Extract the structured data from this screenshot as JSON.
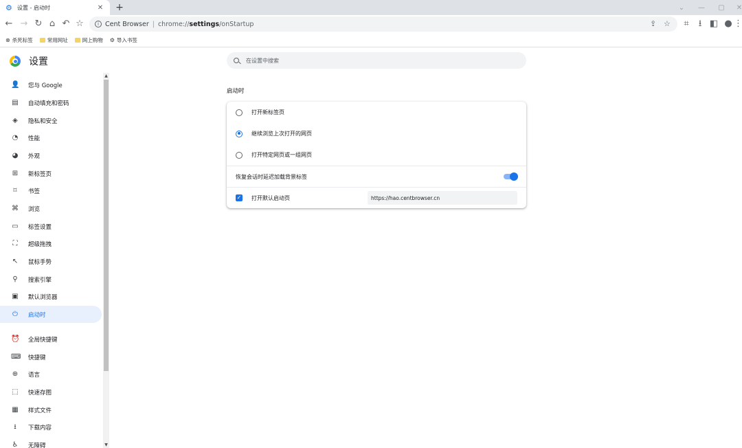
{
  "tab": {
    "title": "设置 - 启动时",
    "favicon": "gear-icon",
    "close": "✕",
    "new_tab": "+"
  },
  "window_controls": [
    "chevron-down-icon",
    "minimize-icon",
    "restore-icon",
    "close-icon"
  ],
  "toolbar": {
    "nav_icons": [
      "back-icon",
      "forward-icon",
      "reload-icon",
      "home-icon",
      "undo-close-icon",
      "star-icon"
    ],
    "site_name": "Cent Browser",
    "url_prefix": "chrome://",
    "url_bold": "settings",
    "url_suffix": "/onStartup",
    "right_icons": [
      "share-icon",
      "bookmark-star-icon",
      "crop-icon",
      "download-icon",
      "sidepanel-icon",
      "profile-icon",
      "menu-icon"
    ]
  },
  "bookmarks": [
    {
      "label": "杀死标签",
      "icon": "kill-tab-icon"
    },
    {
      "label": "常用网址",
      "icon": "folder-icon"
    },
    {
      "label": "网上购物",
      "icon": "folder-icon"
    },
    {
      "label": "导入书签",
      "icon": "gear-icon"
    }
  ],
  "header": {
    "title": "设置",
    "search_placeholder": "在设置中搜索"
  },
  "sidebar": {
    "items": [
      {
        "label": "您与 Google",
        "icon": "person-icon",
        "glyph": "👤"
      },
      {
        "label": "自动填充和密码",
        "icon": "clipboard-icon",
        "glyph": "▤"
      },
      {
        "label": "隐私和安全",
        "icon": "shield-icon",
        "glyph": "◈"
      },
      {
        "label": "性能",
        "icon": "speedometer-icon",
        "glyph": "◔"
      },
      {
        "label": "外观",
        "icon": "palette-icon",
        "glyph": "◕"
      },
      {
        "label": "新标签页",
        "icon": "new-tab-icon",
        "glyph": "⊞"
      },
      {
        "label": "书签",
        "icon": "bookmark-icon",
        "glyph": "⌑"
      },
      {
        "label": "浏览",
        "icon": "browse-icon",
        "glyph": "⌘"
      },
      {
        "label": "标签设置",
        "icon": "tab-icon",
        "glyph": "▭"
      },
      {
        "label": "超级拖拽",
        "icon": "drag-icon",
        "glyph": "⛶"
      },
      {
        "label": "鼠标手势",
        "icon": "cursor-icon",
        "glyph": "↖"
      },
      {
        "label": "搜索引擎",
        "icon": "search-icon",
        "glyph": "⚲"
      },
      {
        "label": "默认浏览器",
        "icon": "browser-window-icon",
        "glyph": "▣"
      },
      {
        "label": "启动时",
        "icon": "power-icon",
        "glyph": "⏻",
        "active": true
      },
      {
        "label": "全局快捷键",
        "icon": "alarm-icon",
        "glyph": "⏰"
      },
      {
        "label": "快捷键",
        "icon": "keyboard-icon",
        "glyph": "⌨"
      },
      {
        "label": "语言",
        "icon": "globe-icon",
        "glyph": "⊕"
      },
      {
        "label": "快速存图",
        "icon": "save-image-icon",
        "glyph": "⬚"
      },
      {
        "label": "样式文件",
        "icon": "stylesheet-icon",
        "glyph": "▦"
      },
      {
        "label": "下载内容",
        "icon": "download-icon",
        "glyph": "⭳"
      },
      {
        "label": "无障碍",
        "icon": "accessibility-icon",
        "glyph": "♿"
      }
    ]
  },
  "startup": {
    "section_title": "启动时",
    "options": [
      {
        "label": "打开新标签页",
        "checked": false
      },
      {
        "label": "继续浏览上次打开的网页",
        "checked": true
      },
      {
        "label": "打开特定网页或一组网页",
        "checked": false
      }
    ],
    "delay_toggle": {
      "label": "恢复会话时延迟加载背景标签",
      "on": true
    },
    "default_startup": {
      "label": "打开默认启动页",
      "checked": true,
      "url": "https://hao.centbrowser.cn"
    }
  },
  "colors": {
    "accent": "#1a73e8",
    "active_bg": "#e8f0fe",
    "toolbar_bg": "#dee1e6"
  }
}
